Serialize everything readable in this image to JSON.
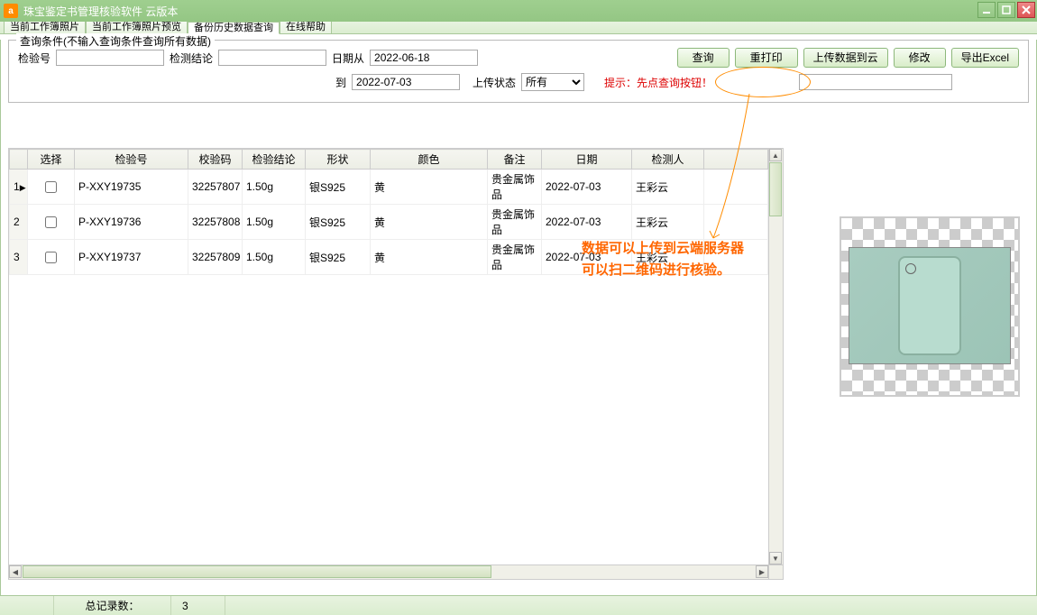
{
  "window": {
    "title": "珠宝鉴定书管理核验软件 云版本"
  },
  "tabs": [
    {
      "label": "当前工作簿照片"
    },
    {
      "label": "当前工作簿照片预览"
    },
    {
      "label": "备份历史数据查询",
      "active": true
    },
    {
      "label": "在线帮助"
    }
  ],
  "groupbox": {
    "legend": "查询条件(不输入查询条件查询所有数据)"
  },
  "form": {
    "check_no_label": "检验号",
    "check_no": "",
    "conclusion_label": "检测结论",
    "conclusion": "",
    "date_from_label": "日期从",
    "date_from": "2022-06-18",
    "date_to_label": "到",
    "date_to": "2022-07-03",
    "upload_status_label": "上传状态",
    "upload_status": "所有",
    "hint": "提示：先点查询按钮！",
    "right_input": ""
  },
  "buttons": {
    "query": "查询",
    "reprint": "重打印",
    "upload": "上传数据到云",
    "modify": "修改",
    "export": "导出Excel"
  },
  "table": {
    "headers": {
      "select": "选择",
      "check_no": "检验号",
      "check_code": "校验码",
      "conclusion": "检验结论",
      "shape": "形状",
      "color": "颜色",
      "remark": "备注",
      "date": "日期",
      "inspector": "检测人"
    },
    "rows": [
      {
        "n": "1",
        "current": true,
        "check_no": "P-XXY19735",
        "check_code": "32257807",
        "conclusion": "1.50g",
        "shape": "银S925",
        "color": "黄",
        "remark": "贵金属饰品",
        "date": "2022-07-03",
        "inspector": "王彩云"
      },
      {
        "n": "2",
        "current": false,
        "check_no": "P-XXY19736",
        "check_code": "32257808",
        "conclusion": "1.50g",
        "shape": "银S925",
        "color": "黄",
        "remark": "贵金属饰品",
        "date": "2022-07-03",
        "inspector": "王彩云"
      },
      {
        "n": "3",
        "current": false,
        "check_no": "P-XXY19737",
        "check_code": "32257809",
        "conclusion": "1.50g",
        "shape": "银S925",
        "color": "黄",
        "remark": "贵金属饰品",
        "date": "2022-07-03",
        "inspector": "王彩云"
      }
    ]
  },
  "statusbar": {
    "label": "总记录数：",
    "count": "3"
  },
  "annotations": {
    "line1": "数据可以上传到云端服务器",
    "line2": "可以扫二维码进行核验。"
  }
}
